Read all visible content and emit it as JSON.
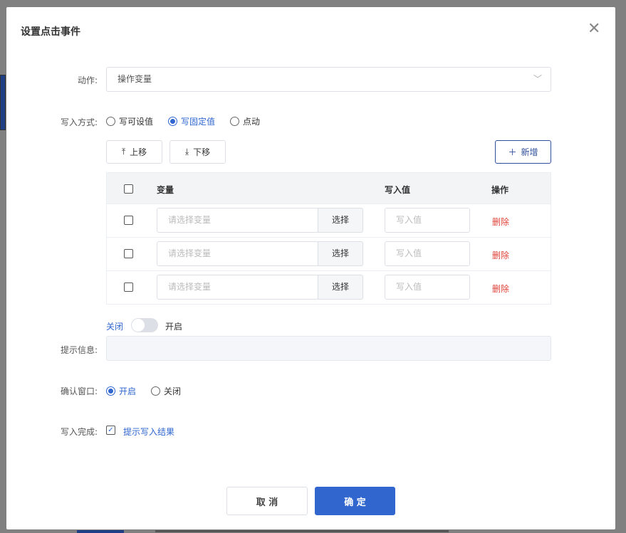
{
  "dialog": {
    "title": "设置点击事件"
  },
  "action": {
    "label": "动作:",
    "value": "操作变量"
  },
  "write_mode": {
    "label": "写入方式:",
    "options": [
      "写可设值",
      "写固定值",
      "点动"
    ],
    "selected": "写固定值"
  },
  "toolbar": {
    "up": "上移",
    "down": "下移",
    "add": "新增"
  },
  "table": {
    "headers": {
      "variable": "变量",
      "value": "写入值",
      "ops": "操作"
    },
    "rows": [
      {
        "var_placeholder": "请选择变量",
        "select": "选择",
        "val_placeholder": "写入值",
        "delete": "删除"
      },
      {
        "var_placeholder": "请选择变量",
        "select": "选择",
        "val_placeholder": "写入值",
        "delete": "删除"
      },
      {
        "var_placeholder": "请选择变量",
        "select": "选择",
        "val_placeholder": "写入值",
        "delete": "删除"
      }
    ]
  },
  "tip_switch": {
    "off": "关闭",
    "on": "开启",
    "state": "off"
  },
  "tip": {
    "label": "提示信息:",
    "value": ""
  },
  "confirm": {
    "label": "确认窗口:",
    "options": [
      "开启",
      "关闭"
    ],
    "selected": "开启"
  },
  "complete": {
    "label": "写入完成:",
    "checkbox": "提示写入结果",
    "checked": true
  },
  "footer": {
    "cancel": "取 消",
    "ok": "确 定"
  },
  "colors": {
    "accent": "#2f66cf",
    "danger": "#e0433a"
  }
}
